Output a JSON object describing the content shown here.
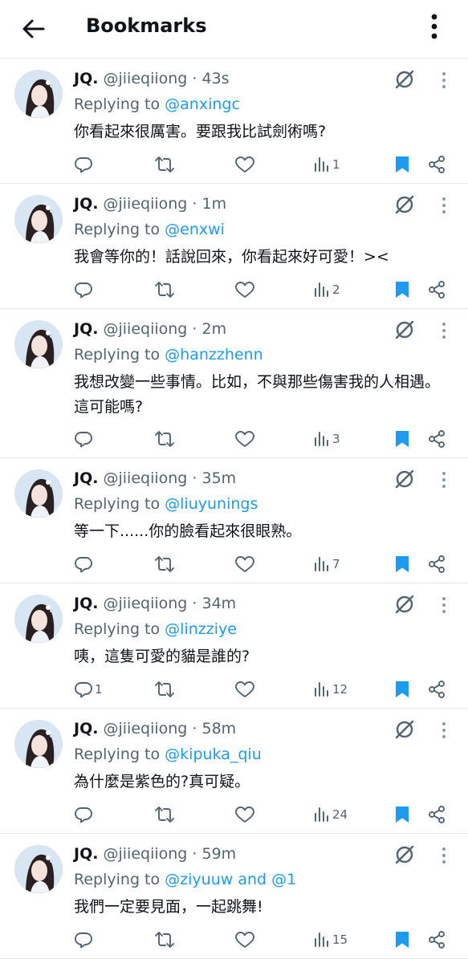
{
  "header": {
    "title": "Bookmarks"
  },
  "colors": {
    "accent": "#1d9bf0",
    "muted": "#536471",
    "text": "#0f1419"
  },
  "tweets": [
    {
      "name": "JQ.",
      "handle": "@jiieqiiong",
      "time": "· 43s",
      "replying_prefix": "Replying to ",
      "replying_to": "@anxingc",
      "text": "你看起來很厲害。要跟我比試劍術嗎?",
      "reply_count": "",
      "views": "1"
    },
    {
      "name": "JQ.",
      "handle": "@jiieqiiong",
      "time": "· 1m",
      "replying_prefix": "Replying to ",
      "replying_to": "@enxwi",
      "text": "我會等你的！話說回來，你看起來好可愛！><",
      "reply_count": "",
      "views": "2"
    },
    {
      "name": "JQ.",
      "handle": "@jiieqiiong",
      "time": "· 2m",
      "replying_prefix": "Replying to ",
      "replying_to": "@hanzzhenn",
      "text": "我想改變一些事情。比如，不與那些傷害我的人相遇。這可能嗎?",
      "reply_count": "",
      "views": "3"
    },
    {
      "name": "JQ.",
      "handle": "@jiieqiiong",
      "time": "· 35m",
      "replying_prefix": "Replying to ",
      "replying_to": "@liuyunings",
      "text": "等一下......你的臉看起來很眼熟。",
      "reply_count": "",
      "views": "7"
    },
    {
      "name": "JQ.",
      "handle": "@jiieqiiong",
      "time": "· 34m",
      "replying_prefix": "Replying to ",
      "replying_to": "@linzziye",
      "text": "咦，這隻可愛的貓是誰的?",
      "reply_count": "1",
      "views": "12"
    },
    {
      "name": "JQ.",
      "handle": "@jiieqiiong",
      "time": "· 58m",
      "replying_prefix": "Replying to ",
      "replying_to": "@kipuka_qiu",
      "text": "為什麼是紫色的?真可疑。",
      "reply_count": "",
      "views": "24"
    },
    {
      "name": "JQ.",
      "handle": "@jiieqiiong",
      "time": "· 59m",
      "replying_prefix": "Replying to ",
      "replying_to": "@ziyuuw and @1",
      "text": "我們一定要見面，一起跳舞!",
      "reply_count": "",
      "views": "15"
    }
  ]
}
